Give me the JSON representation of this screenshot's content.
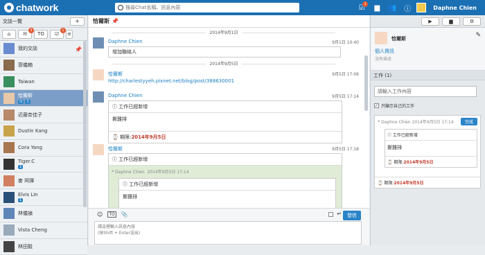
{
  "topbar": {
    "logo_text": "chatwork",
    "search_placeholder": "搜尋Chat名稱、訊息內容",
    "username": "Daphne Chien",
    "task_badge": "1",
    "colors": {
      "bar": "#1b6fb3",
      "badge": "#e4572e"
    }
  },
  "sidebar": {
    "title": "交談一覽",
    "add_label": "+",
    "filters": [
      {
        "icon": "home-icon",
        "badge": ""
      },
      {
        "icon": "chat-bubble-icon",
        "badge": "3"
      },
      {
        "icon": "to-icon",
        "badge": ""
      },
      {
        "icon": "task-check-icon",
        "badge": "1"
      }
    ],
    "rooms": [
      {
        "name": "我的交談",
        "pinned": true,
        "chips": []
      },
      {
        "name": "郭儀楠",
        "pinned": false,
        "chips": []
      },
      {
        "name": "Taiwan",
        "pinned": false,
        "chips": []
      },
      {
        "name": "恰爾斯",
        "pinned": false,
        "chips": [
          "☑",
          "1"
        ],
        "active": true
      },
      {
        "name": "近藤奈佳子",
        "pinned": false,
        "chips": []
      },
      {
        "name": "Dustin Kang",
        "pinned": false,
        "chips": []
      },
      {
        "name": "Cora Yang",
        "pinned": false,
        "chips": []
      },
      {
        "name": "Tiger.C",
        "pinned": false,
        "chips": [
          "1"
        ]
      },
      {
        "name": "麥 阿揮",
        "pinned": false,
        "chips": []
      },
      {
        "name": "Elvis Lin",
        "pinned": false,
        "chips": [
          "1"
        ]
      },
      {
        "name": "林儀禎",
        "pinned": false,
        "chips": []
      },
      {
        "name": "Vista Cheng",
        "pinned": false,
        "chips": []
      },
      {
        "name": "林田毅",
        "pinned": false,
        "chips": []
      }
    ]
  },
  "main": {
    "title": "恰爾斯",
    "date1": "2014年9月1日",
    "date2": "2014年9月5日",
    "msg1": {
      "who": "Daphne Chien",
      "time": "9月1日 10:40",
      "text": "增加聯絡人"
    },
    "msg2": {
      "who": "恰爾斯",
      "time": "9月5日 17:06",
      "text": "http://charlestyyeh.pixnet.net/blog/post/388630001"
    },
    "msg3": {
      "who": "Daphne Chien",
      "time": "9月5日 17:14",
      "task_header": "工作已經新增",
      "task_body": "撕雞排",
      "deadline_label": "期限:",
      "deadline": "2014年9月5日"
    },
    "msg4": {
      "who": "恰爾斯",
      "time": "9月5日 17:18",
      "task_header": "工作已經新增",
      "quote_who": "Daphne Chien",
      "quote_time": "2014年9月5日 17:14",
      "inner_header": "工作已經新增",
      "inner_body": "撕雞排"
    },
    "composer": {
      "send_label": "發信",
      "placeholder_line1": "請這裡輸入訊息內容",
      "placeholder_line2": "(按Shift + Enter送出)"
    }
  },
  "right": {
    "profile_name": "恰爾斯",
    "profile_link": "個人資訊",
    "profile_desc": "沒有描述",
    "task_title": "工作 (1)",
    "task_placeholder": "請輸入工作內容",
    "only_mine_label": "只顯示自己的工作",
    "card": {
      "quote_who": "Daphne Chien",
      "quote_time": "2014年9月5日 17:14",
      "done_label": "完成",
      "inner_header": "工作已經新增",
      "inner_body": "撕雞排",
      "deadline_label": "期限:",
      "deadline": "2014年9月5日",
      "bottom_deadline_label": "期限:",
      "bottom_deadline": "2014年9月5日"
    }
  }
}
